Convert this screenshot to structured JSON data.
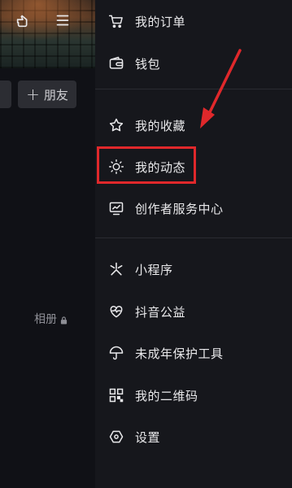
{
  "profile": {
    "add_friend_label": "朋友",
    "album_label": "相册"
  },
  "menu": {
    "orders": "我的订单",
    "wallet": "钱包",
    "favorites": "我的收藏",
    "moments": "我的动态",
    "creator_center": "创作者服务中心",
    "mini_programs": "小程序",
    "charity": "抖音公益",
    "minor_protection": "未成年保护工具",
    "qr_code": "我的二维码",
    "settings": "设置"
  },
  "colors": {
    "highlight": "#e0282b",
    "background": "#16171c"
  }
}
